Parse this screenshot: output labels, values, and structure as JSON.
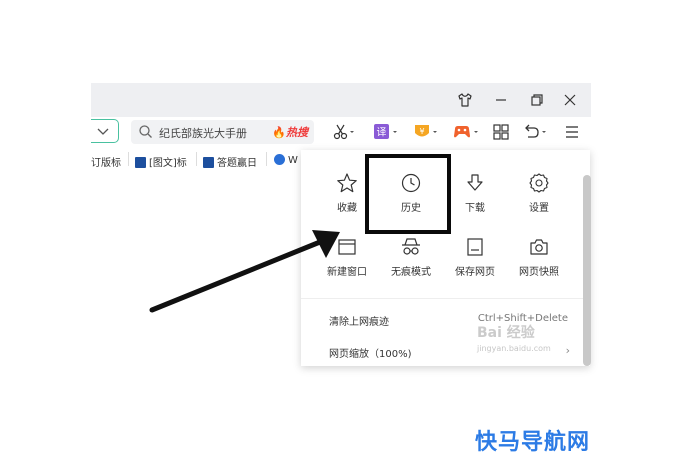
{
  "titlebar": {
    "skin_icon": "tshirt-icon",
    "minimize_icon": "minimize-icon",
    "restore_icon": "restore-icon",
    "close_icon": "close-icon"
  },
  "toolbar": {
    "search_placeholder": "纪氏部族光大手册",
    "hot_label": "热搜",
    "translate_label": "译",
    "icons": [
      "scissors-icon",
      "translate-icon",
      "vip-icon",
      "game-icon",
      "grid-icon",
      "undo-icon",
      "menu-icon"
    ]
  },
  "bookmarks": [
    {
      "label": "订版标"
    },
    {
      "label": "[图文]标"
    },
    {
      "label": "答题赢日"
    },
    {
      "label": "W"
    }
  ],
  "menu": {
    "grid": [
      {
        "label": "收藏",
        "icon": "star-icon"
      },
      {
        "label": "历史",
        "icon": "clock-icon"
      },
      {
        "label": "下载",
        "icon": "download-icon"
      },
      {
        "label": "设置",
        "icon": "gear-icon"
      },
      {
        "label": "新建窗口",
        "icon": "new-window-icon"
      },
      {
        "label": "无痕模式",
        "icon": "incognito-icon"
      },
      {
        "label": "保存网页",
        "icon": "save-icon"
      },
      {
        "label": "网页快照",
        "icon": "camera-icon"
      }
    ],
    "clear_trace": "清除上网痕迹",
    "clear_shortcut": "Ctrl+Shift+Delete",
    "zoom": "网页缩放（100%)"
  },
  "watermark": {
    "text": "快马导航网",
    "baidu": "Bai 经验",
    "baidu_url": "jingyan.baidu.com"
  },
  "colors": {
    "accent_green": "#49c1a0",
    "hot_red": "#ef3b3b",
    "watermark_blue": "#2c7be5"
  }
}
